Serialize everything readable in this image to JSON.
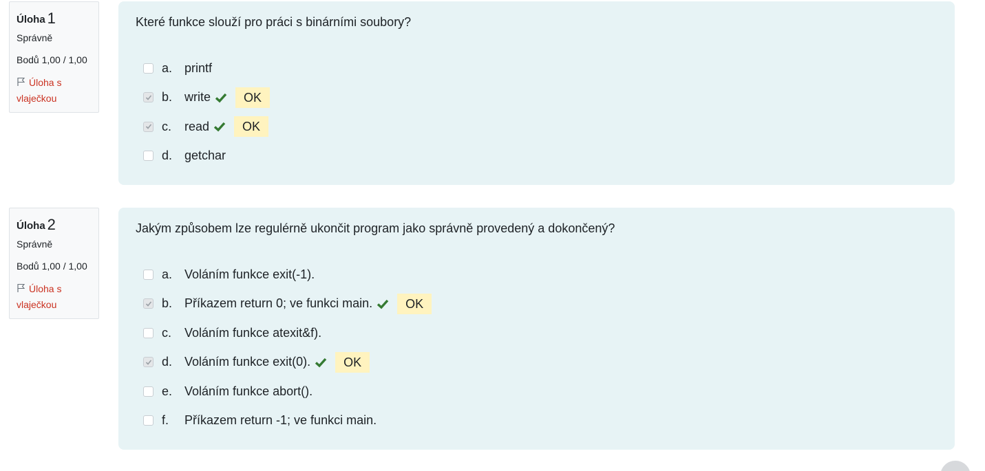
{
  "questions": [
    {
      "info": {
        "label": "Úloha",
        "number": "1",
        "state": "Správně",
        "grade": "Bodů 1,00 / 1,00",
        "flag_label": "Úloha s vlaječkou"
      },
      "text": "Které funkce slouží pro práci s binárními soubory?",
      "answers": [
        {
          "letter": "a.",
          "text": "printf",
          "checked": false,
          "correct": false
        },
        {
          "letter": "b.",
          "text": "write",
          "checked": true,
          "correct": true,
          "feedback": "OK"
        },
        {
          "letter": "c.",
          "text": "read",
          "checked": true,
          "correct": true,
          "feedback": "OK"
        },
        {
          "letter": "d.",
          "text": "getchar",
          "checked": false,
          "correct": false
        }
      ]
    },
    {
      "info": {
        "label": "Úloha",
        "number": "2",
        "state": "Správně",
        "grade": "Bodů 1,00 / 1,00",
        "flag_label": "Úloha s vlaječkou"
      },
      "text": "Jakým způsobem lze regulérně ukončit program jako správně provedený a dokončený?",
      "answers": [
        {
          "letter": "a.",
          "text": "Voláním funkce exit(-1).",
          "checked": false,
          "correct": false
        },
        {
          "letter": "b.",
          "text": "Příkazem return 0; ve funkci main.",
          "checked": true,
          "correct": true,
          "feedback": "OK"
        },
        {
          "letter": "c.",
          "text": "Voláním funkce atexit&f).",
          "checked": false,
          "correct": false
        },
        {
          "letter": "d.",
          "text": "Voláním funkce exit(0).",
          "checked": true,
          "correct": true,
          "feedback": "OK"
        },
        {
          "letter": "e.",
          "text": "Voláním funkce abort().",
          "checked": false,
          "correct": false
        },
        {
          "letter": "f.",
          "text": "Příkazem return -1; ve funkci main.",
          "checked": false,
          "correct": false
        }
      ]
    }
  ],
  "colors": {
    "content_bg": "#e7f3f5",
    "info_bg": "#f8f9fa",
    "flag": "#ca3120",
    "correct_tick": "#357a32",
    "feedback_bg": "#fff3bf"
  },
  "icons": {
    "flag": "flag-icon",
    "tick": "check-icon",
    "scroll": "back-to-top-button"
  }
}
